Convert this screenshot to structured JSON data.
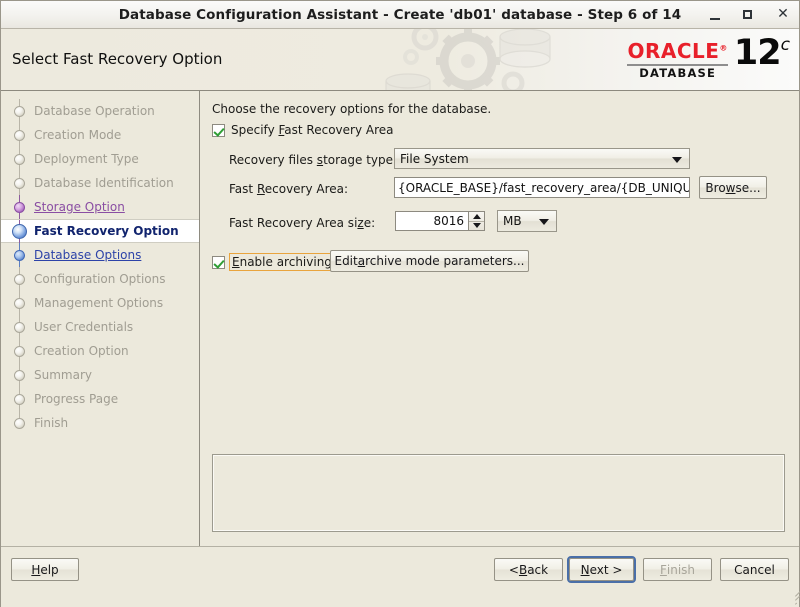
{
  "window": {
    "title": "Database Configuration Assistant - Create 'db01' database - Step 6 of 14",
    "minimize_label": "_",
    "maximize_label": "□",
    "close_label": "✕"
  },
  "header": {
    "page_title": "Select Fast Recovery Option",
    "logo": {
      "brand": "ORACLE",
      "trademark": "®",
      "product": "DATABASE",
      "version": "12",
      "version_suffix": "c"
    }
  },
  "sidebar": {
    "items": [
      {
        "label": "Database Operation",
        "state": "done"
      },
      {
        "label": "Creation Mode",
        "state": "done"
      },
      {
        "label": "Deployment Type",
        "state": "done"
      },
      {
        "label": "Database Identification",
        "state": "done"
      },
      {
        "label": "Storage Option",
        "state": "visited"
      },
      {
        "label": "Fast Recovery Option",
        "state": "current"
      },
      {
        "label": "Database Options",
        "state": "enabled"
      },
      {
        "label": "Configuration Options",
        "state": "done"
      },
      {
        "label": "Management Options",
        "state": "done"
      },
      {
        "label": "User Credentials",
        "state": "done"
      },
      {
        "label": "Creation Option",
        "state": "done"
      },
      {
        "label": "Summary",
        "state": "done"
      },
      {
        "label": "Progress Page",
        "state": "done"
      },
      {
        "label": "Finish",
        "state": "done"
      }
    ]
  },
  "main": {
    "intro": "Choose the recovery options for the database.",
    "specify_fra": {
      "label_pre": "Specify ",
      "label_mnemonic": "F",
      "label_post": "ast Recovery Area",
      "checked": true
    },
    "storage_type": {
      "label_pre": "Recovery files ",
      "label_mnemonic": "s",
      "label_post": "torage type:",
      "value": "File System"
    },
    "fra_path": {
      "label_pre": "Fast ",
      "label_mnemonic": "R",
      "label_post": "ecovery Area:",
      "value": "{ORACLE_BASE}/fast_recovery_area/{DB_UNIQUE_",
      "browse_pre": "Bro",
      "browse_mnemonic": "w",
      "browse_post": "se..."
    },
    "fra_size": {
      "label_pre": "Fast Recovery Area si",
      "label_mnemonic": "z",
      "label_post": "e:",
      "value": "8016",
      "unit": "MB"
    },
    "enable_archiving": {
      "label_mnemonic": "E",
      "label_post": "nable archiving",
      "checked": true,
      "focused": true,
      "button_pre": "Edit ",
      "button_mnemonic": "a",
      "button_post": "rchive mode parameters..."
    },
    "message_panel": ""
  },
  "footer": {
    "help_mnemonic": "H",
    "help_post": "elp",
    "back_pre": "< ",
    "back_mnemonic": "B",
    "back_post": "ack",
    "next_mnemonic": "N",
    "next_post": "ext >",
    "finish_mnemonic": "F",
    "finish_post": "inish",
    "cancel": "Cancel"
  }
}
